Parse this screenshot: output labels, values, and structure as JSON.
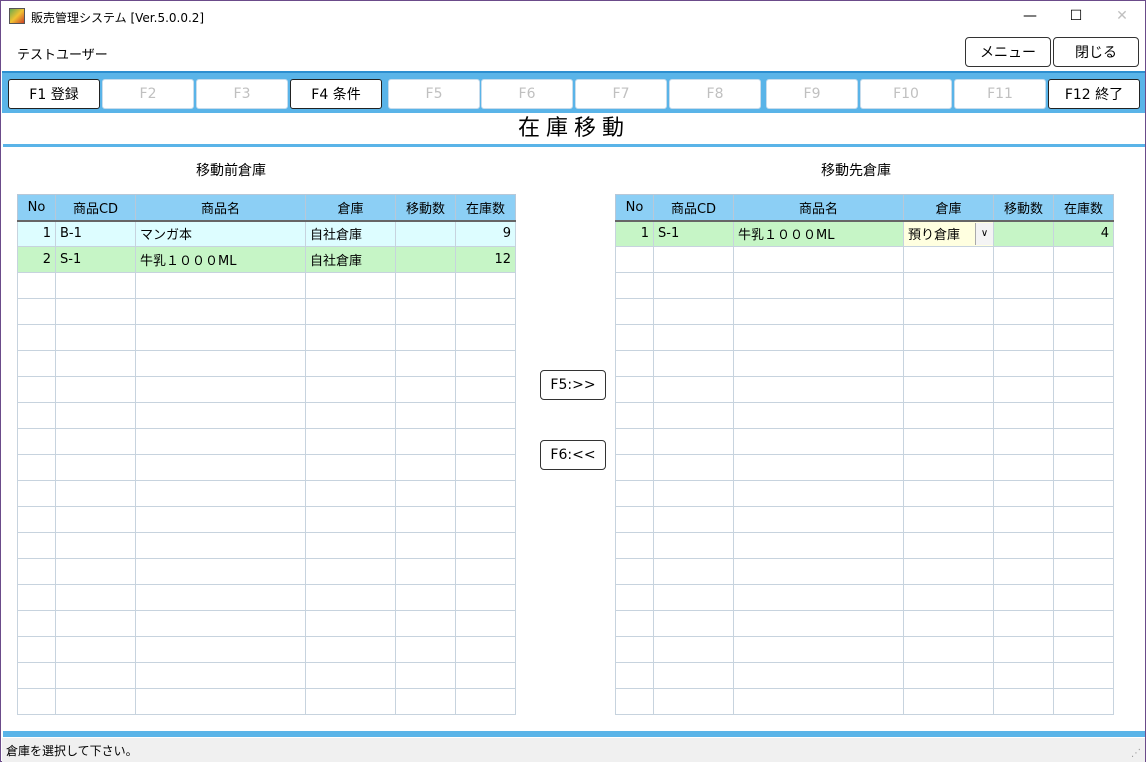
{
  "window": {
    "title": "販売管理システム [Ver.5.0.0.2]",
    "controls": {
      "minimize": "—",
      "maximize": "☐",
      "close": "✕"
    }
  },
  "header": {
    "user_name": "テストユーザー",
    "menu_label": "メニュー",
    "close_label": "閉じる"
  },
  "function_keys": [
    {
      "label": "F1 登録",
      "enabled": true
    },
    {
      "label": "F2",
      "enabled": false
    },
    {
      "label": "F3",
      "enabled": false
    },
    {
      "label": "F4 条件",
      "enabled": true
    },
    {
      "label": "F5",
      "enabled": false
    },
    {
      "label": "F6",
      "enabled": false
    },
    {
      "label": "F7",
      "enabled": false
    },
    {
      "label": "F8",
      "enabled": false
    },
    {
      "label": "F9",
      "enabled": false
    },
    {
      "label": "F10",
      "enabled": false
    },
    {
      "label": "F11",
      "enabled": false
    },
    {
      "label": "F12 終了",
      "enabled": true
    }
  ],
  "screen_title": "在庫移動",
  "source": {
    "caption": "移動前倉庫",
    "columns": [
      "No",
      "商品CD",
      "商品名",
      "倉庫",
      "移動数",
      "在庫数"
    ],
    "rows": [
      {
        "no": "1",
        "code": "B-1",
        "name": "マンガ本",
        "warehouse": "自社倉庫",
        "move_qty": "",
        "stock": "9",
        "style": "cyan"
      },
      {
        "no": "2",
        "code": "S-1",
        "name": "牛乳１０００ML",
        "warehouse": "自社倉庫",
        "move_qty": "",
        "stock": "12",
        "style": "green"
      }
    ],
    "empty_rows": 17
  },
  "move_buttons": {
    "forward_label": "F5:>>",
    "back_label": "F6:<<"
  },
  "destination": {
    "caption": "移動先倉庫",
    "columns": [
      "No",
      "商品CD",
      "商品名",
      "倉庫",
      "移動数",
      "在庫数"
    ],
    "rows": [
      {
        "no": "1",
        "code": "S-1",
        "name": "牛乳１０００ML",
        "warehouse": "預り倉庫",
        "move_qty": "",
        "stock": "4",
        "style": "green",
        "warehouse_is_combo": true
      }
    ],
    "empty_rows": 18
  },
  "status": {
    "message": "倉庫を選択して下さい。"
  },
  "colors": {
    "accent_bar": "#5ab4e8",
    "header_cell": "#8ccff5",
    "row_cyan": "#ddfdff",
    "row_green": "#c6f5c6",
    "combo_bg": "#ffffe0"
  }
}
